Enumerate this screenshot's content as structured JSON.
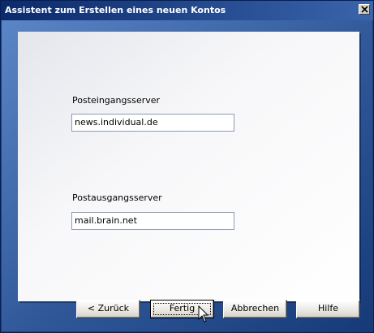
{
  "window": {
    "title": "Assistent zum Erstellen eines neuen Kontos",
    "close_icon": "close-icon"
  },
  "form": {
    "incoming_label": "Posteingangsserver",
    "incoming_value": "news.individual.de",
    "outgoing_label": "Postausgangsserver",
    "outgoing_value": "mail.brain.net"
  },
  "buttons": {
    "back": "< Zurück",
    "finish": "Fertig",
    "cancel": "Abbrechen",
    "help": "Hilfe"
  },
  "colors": {
    "titlebar": "#0b2a6b",
    "background": "#2f5798",
    "panel": "#f7f7f9"
  }
}
